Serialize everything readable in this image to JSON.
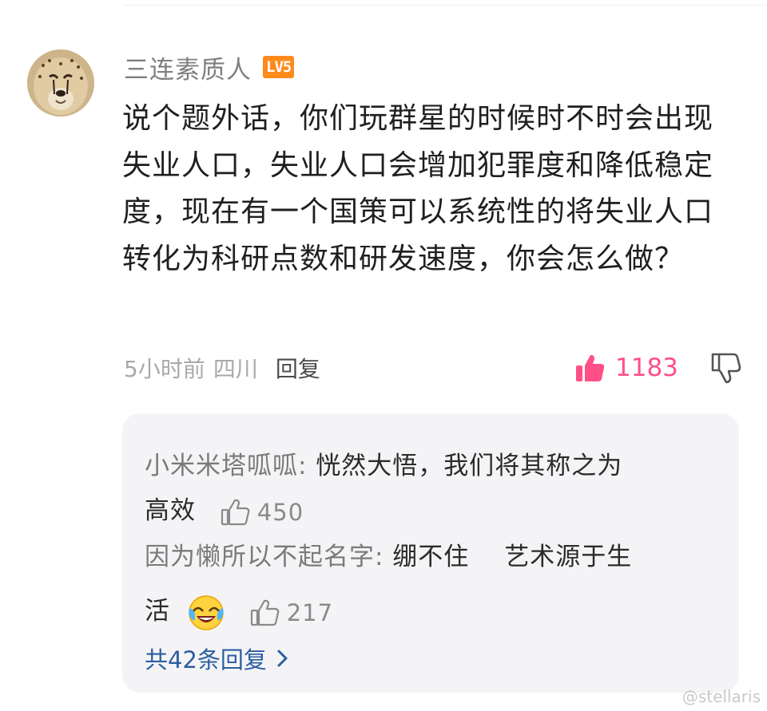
{
  "comment": {
    "username": "三连素质人",
    "level_badge": "LV5",
    "text": "说个题外话，你们玩群星的时候时不时会出现失业人口，失业人口会增加犯罪度和降低稳定度，现在有一个国策可以系统性的将失业人口转化为科研点数和研发速度，你会怎么做？",
    "time": "5小时前",
    "location": "四川",
    "reply_label": "回复",
    "like_count": "1183",
    "like_color": "#ff4f86"
  },
  "replies": {
    "items": [
      {
        "author": "小米米塔呱呱:",
        "text_line1": " 恍然大悟，我们将其称之为",
        "text_line2": "高效",
        "likes": "450"
      },
      {
        "author": "因为懒所以不起名字:",
        "text_line1": " 绷不住",
        "text_line1b": "艺术源于生",
        "text_line2": "活",
        "emoji": "laughing-crying-face",
        "likes": "217"
      }
    ],
    "more_label": "共42条回复"
  },
  "watermark": "@stellaris"
}
